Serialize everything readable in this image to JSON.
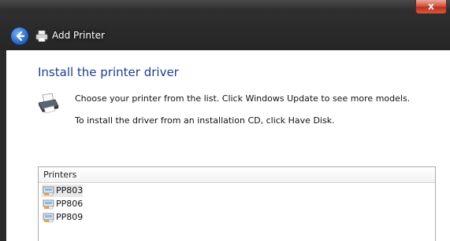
{
  "window": {
    "title": "Add Printer",
    "close_label": "x"
  },
  "page": {
    "heading": "Install the printer driver",
    "instruction_1": "Choose your printer from the list. Click Windows Update to see more models.",
    "instruction_2": "To install the driver from an installation CD, click Have Disk."
  },
  "printer_list": {
    "header": "Printers",
    "items": [
      {
        "label": "PP803",
        "selected": true
      },
      {
        "label": "PP806",
        "selected": false
      },
      {
        "label": "PP809",
        "selected": false
      }
    ]
  },
  "colors": {
    "heading": "#1e3d8c",
    "titlebar": "#262626",
    "close_button": "#c0301b",
    "selection": "#e8e8e8"
  },
  "icons": {
    "back": "back-arrow-icon",
    "title": "printer-icon",
    "page": "printer-icon",
    "list_item": "printer-driver-icon"
  }
}
